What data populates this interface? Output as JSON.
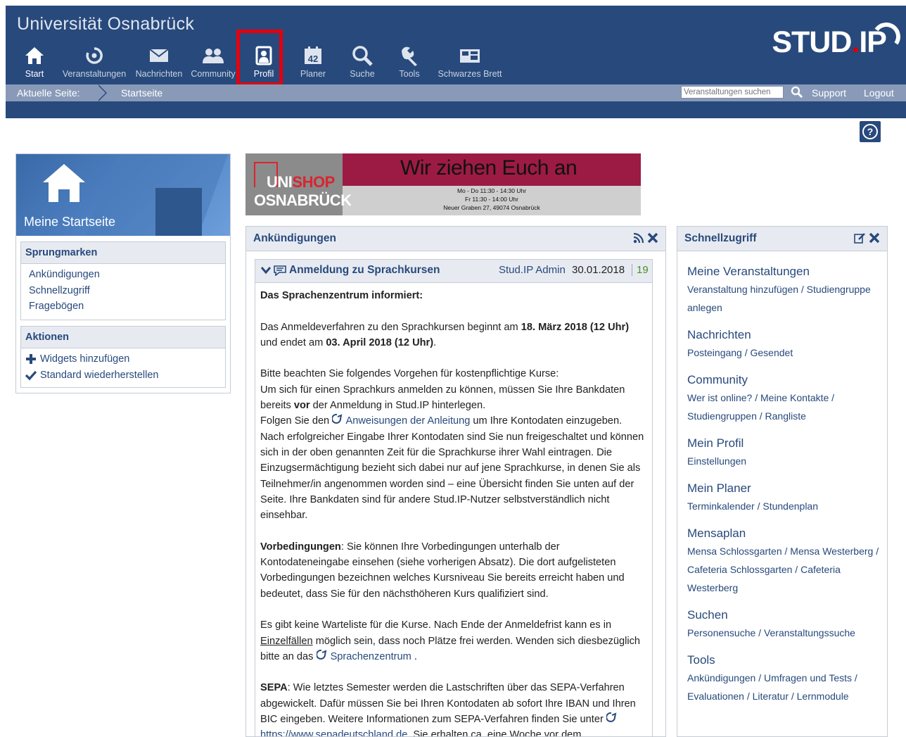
{
  "header": {
    "university": "Universität Osnabrück",
    "logo_main": "STUD",
    "logo_dot": ".",
    "logo_ip": "IP"
  },
  "nav": [
    {
      "label": "Start",
      "icon": "home-icon"
    },
    {
      "label": "Veranstaltungen",
      "icon": "seminar-icon"
    },
    {
      "label": "Nachrichten",
      "icon": "mail-icon"
    },
    {
      "label": "Community",
      "icon": "community-icon"
    },
    {
      "label": "Profil",
      "icon": "profile-icon"
    },
    {
      "label": "Planer",
      "icon": "calendar-icon"
    },
    {
      "label": "Suche",
      "icon": "search-icon"
    },
    {
      "label": "Tools",
      "icon": "tools-icon"
    },
    {
      "label": "Schwarzes Brett",
      "icon": "board-icon"
    }
  ],
  "breadcrumb": {
    "label": "Aktuelle Seite:",
    "page": "Startseite",
    "search_placeholder": "Veranstaltungen suchen",
    "support": "Support",
    "logout": "Logout"
  },
  "sidebar": {
    "title": "Meine Startseite",
    "jump_title": "Sprungmarken",
    "jump_items": [
      "Ankündigungen",
      "Schnellzugriff",
      "Fragebögen"
    ],
    "actions_title": "Aktionen",
    "actions": [
      "Widgets hinzufügen",
      "Standard wiederherstellen"
    ]
  },
  "banner": {
    "headline": "Wir ziehen Euch an",
    "brand_a": "UNI",
    "brand_b": "SHOP",
    "brand_city": "OSNABRÜCK",
    "line1": "Mo - Do 11:30 - 14:30 Uhr",
    "line2": "Fr   11:30 - 14:00 Uhr",
    "line3": "Neuer Graben 27, 49074 Osnabrück"
  },
  "announcements": {
    "widget_title": "Ankündigungen",
    "item_title": "Anmeldung zu Sprachkursen",
    "author": "Stud.IP Admin",
    "date": "30.01.2018",
    "views": "19",
    "p1": "Das Sprachenzentrum informiert:",
    "p2a": "Das Anmeldeverfahren zu den Sprachkursen beginnt am ",
    "p2b": "18. März 2018 (12 Uhr)",
    "p2c": " und endet am ",
    "p2d": "03. April 2018 (12 Uhr)",
    "p2e": ".",
    "p3a": "Bitte beachten Sie folgendes Vorgehen für kostenpflichtige Kurse:",
    "p3b": "Um sich für einen Sprachkurs anmelden zu können, müssen Sie Ihre Bankdaten bereits ",
    "p3c": "vor",
    "p3d": " der Anmeldung in Stud.IP hinterlegen.",
    "p3e": "Folgen Sie den ",
    "p3f": "Anweisungen der Anleitung",
    "p3g": " um Ihre Kontodaten einzugeben. Nach erfolgreicher Eingabe Ihrer Kontodaten sind Sie nun freigeschaltet und können sich in der oben genannten Zeit für die Sprachkurse ihrer Wahl eintragen. Die Einzugsermächtigung bezieht sich dabei nur auf jene Sprachkurse, in denen Sie als Teilnehmer/in angenommen worden sind – eine Übersicht finden Sie unten auf der Seite. Ihre Bankdaten sind für andere Stud.IP-Nutzer selbstverständlich nicht einsehbar.",
    "p4a": "Vorbedingungen",
    "p4b": ": Sie können Ihre Vorbedingungen unterhalb der Kontodateneingabe einsehen (siehe vorherigen Absatz). Die dort aufgelisteten Vorbedingungen bezeichnen welches Kursniveau Sie bereits erreicht haben und bedeutet, dass Sie für den nächsthöheren Kurs qualifiziert sind.",
    "p5a": "Es gibt keine Warteliste für die Kurse. Nach Ende der Anmeldefrist kann es in ",
    "p5b": "Einzelfällen",
    "p5c": " möglich sein, dass noch Plätze frei werden. Wenden sich diesbezüglich bitte an das ",
    "p5d": "Sprachenzentrum",
    "p5e": " .",
    "p6a": "SEPA",
    "p6b": ": Wie letztes Semester werden die Lastschriften über das SEPA-Verfahren abgewickelt. Dafür müssen Sie bei Ihren Kontodaten ab sofort Ihre IBAN und Ihren BIC eingeben. Weitere Informationen zum SEPA-Verfahren finden Sie unter ",
    "p6c": "https://www.sepadeutschland.de",
    "p6d": ". Sie erhalten ca. eine Woche vor dem"
  },
  "quick": {
    "title": "Schnellzugriff",
    "sections": [
      {
        "heading": "Meine Veranstaltungen",
        "links": "Veranstaltung hinzufügen / Studiengruppe anlegen"
      },
      {
        "heading": "Nachrichten",
        "links": "Posteingang / Gesendet"
      },
      {
        "heading": "Community",
        "links": "Wer ist online? / Meine Kontakte / Studiengruppen / Rangliste"
      },
      {
        "heading": "Mein Profil",
        "links": "Einstellungen"
      },
      {
        "heading": "Mein Planer",
        "links": "Terminkalender / Stundenplan"
      },
      {
        "heading": "Mensaplan",
        "links": "Mensa Schlossgarten / Mensa Westerberg / Cafeteria Schlossgarten / Cafeteria Westerberg"
      },
      {
        "heading": "Suchen",
        "links": "Personensuche / Veranstaltungssuche"
      },
      {
        "heading": "Tools",
        "links": "Ankündigungen / Umfragen und Tests / Evaluationen / Literatur / Lernmodule"
      }
    ]
  },
  "colors": {
    "primary": "#28497c",
    "breadcrumb": "#899ab9",
    "highlight": "#e4000f",
    "views": "#4a8e2a"
  }
}
